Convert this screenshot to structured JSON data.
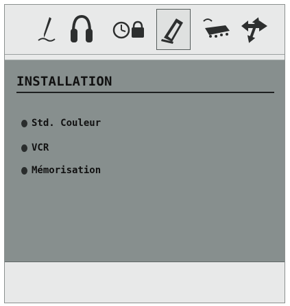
{
  "toolbar": {
    "icons": [
      {
        "name": "picture-pen-icon",
        "active": false
      },
      {
        "name": "headphones-icon",
        "active": false
      },
      {
        "name": "timer-lock-icon",
        "active": false
      },
      {
        "name": "installation-icon",
        "active": true
      },
      {
        "name": "source-connector-icon",
        "active": false
      },
      {
        "name": "settings-arrows-icon",
        "active": false
      }
    ]
  },
  "panel": {
    "title": "INSTALLATION",
    "items": [
      {
        "label": "Std. Couleur"
      },
      {
        "label": "VCR"
      },
      {
        "label": "Mémorisation"
      }
    ]
  },
  "colors": {
    "panel_bg": "#878f8e",
    "toolbar_bg": "#e8e9e9",
    "text": "#111111"
  }
}
